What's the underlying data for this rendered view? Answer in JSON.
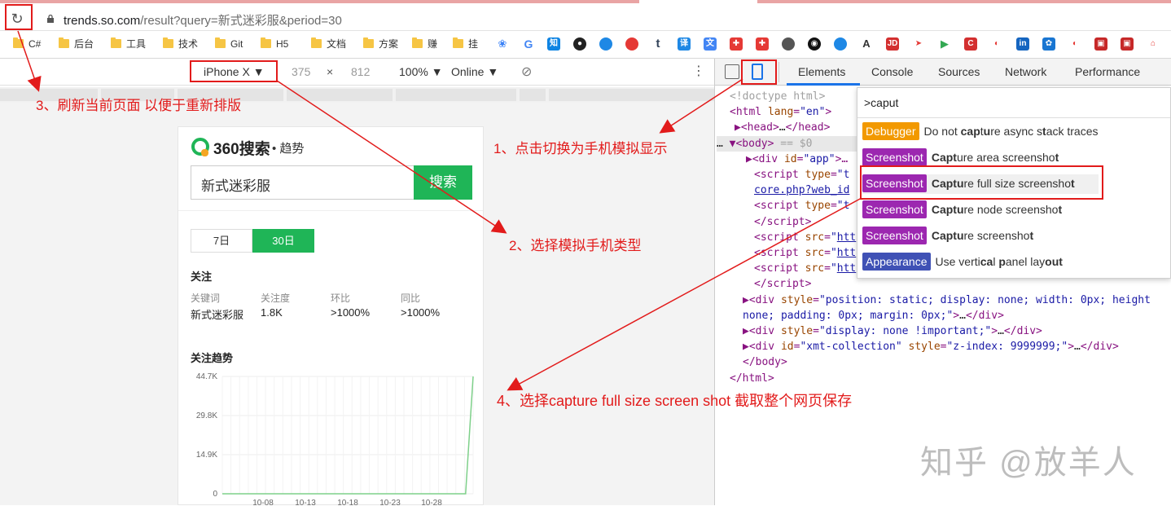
{
  "address_bar": {
    "host": "trends.so.com",
    "path": "/result?query=新式迷彩服&period=30"
  },
  "bookmarks": [
    {
      "type": "folder",
      "label": "C#"
    },
    {
      "type": "folder",
      "label": "后台"
    },
    {
      "type": "folder",
      "label": "工具"
    },
    {
      "type": "folder",
      "label": "技术"
    },
    {
      "type": "folder",
      "label": "Git"
    },
    {
      "type": "folder",
      "label": "H5"
    },
    {
      "type": "folder",
      "label": "文档"
    },
    {
      "type": "folder",
      "label": "方案"
    },
    {
      "type": "folder",
      "label": "赚"
    },
    {
      "type": "folder",
      "label": "挂"
    }
  ],
  "device_toolbar": {
    "device": "iPhone X",
    "width": "375",
    "times": "×",
    "height": "812",
    "zoom": "100%",
    "network": "Online"
  },
  "page": {
    "logo_text": "360搜索",
    "logo_suffix": "• 趋势",
    "search_value": "新式迷彩服",
    "search_button": "搜索",
    "period_tabs": [
      "7日",
      "30日"
    ],
    "section_follow": "关注",
    "stats_headers": [
      "关键词",
      "关注度",
      "环比",
      "同比"
    ],
    "stats_values": [
      "新式迷彩服",
      "1.8K",
      ">1000%",
      ">1000%"
    ],
    "section_trend": "关注趋势"
  },
  "chart_data": {
    "type": "line",
    "title": "关注趋势",
    "y_ticks": [
      "44.7K",
      "29.8K",
      "14.9K",
      "0"
    ],
    "x_ticks": [
      "10-08",
      "10-13",
      "10-18",
      "10-23",
      "10-28"
    ],
    "ylim": [
      0,
      44700
    ],
    "grid": true,
    "series": [
      {
        "color": "#7ed08a",
        "points": [
          [
            0,
            0
          ],
          [
            0.97,
            0
          ],
          [
            1.0,
            44700
          ]
        ]
      }
    ]
  },
  "devtools": {
    "tabs": [
      "Elements",
      "Console",
      "Sources",
      "Network",
      "Performance",
      "M"
    ],
    "dom_lines": [
      {
        "html": "<span class='cm'>&lt;!doctype html&gt;</span>"
      },
      {
        "html": "&lt;html <span class='at'>lang</span>=<span class='av'>\"en\"</span>&gt;"
      },
      {
        "html": "▶&lt;head&gt;<span class='tx'>…</span>&lt;/head&gt;"
      },
      {
        "html": "▼&lt;body&gt; <span class='cm'>== $0</span>"
      },
      {
        "html": "▶&lt;div <span class='at'>id</span>=<span class='av'>\"app\"</span>&gt;…"
      },
      {
        "html": "&lt;script <span class='at'>type</span>=<span class='av'>\"t</span>"
      },
      {
        "html": "<span class='lk'>core.php?web_id</span>"
      },
      {
        "html": "&lt;script <span class='at'>type</span>=<span class='av'>\"t</span>"
      },
      {
        "html": "&lt;/script&gt;"
      },
      {
        "html": "&lt;script <span class='at'>src</span>=<span class='av'>\"<span class='lk'>htt</span></span>"
      },
      {
        "html": "&lt;script <span class='at'>src</span>=<span class='av'>\"<span class='lk'>htt</span></span>"
      },
      {
        "html": "&lt;script <span class='at'>src</span>=<span class='av'>\"<span class='lk'>htt</span></span>"
      },
      {
        "html": "&lt;/script&gt;"
      },
      {
        "html": "▶&lt;div <span class='at'>style</span>=<span class='av'>\"position: static; display: none; width: 0px; height</span>"
      },
      {
        "html": "<span class='av'>none; padding: 0px; margin: 0px;\"</span>&gt;<span class='tx'>…</span>&lt;/div&gt;"
      },
      {
        "html": "▶&lt;div <span class='at'>style</span>=<span class='av'>\"display: none !important;\"</span>&gt;<span class='tx'>…</span>&lt;/div&gt;"
      },
      {
        "html": "▶&lt;div <span class='at'>id</span>=<span class='av'>\"xmt-collection\"</span> <span class='at'>style</span>=<span class='av'>\"z-index: 9999999;\"</span>&gt;<span class='tx'>…</span>&lt;/div&gt;"
      },
      {
        "html": "&lt;/body&gt;"
      },
      {
        "html": "&lt;/html&gt;"
      }
    ],
    "command_query": ">caput",
    "commands": [
      {
        "badge": "Debugger",
        "color": "#f29900",
        "text_html": "Do not <b>cap</b>t<b>u</b>re async s<b>t</b>ack traces"
      },
      {
        "badge": "Screenshot",
        "color": "#9c27b0",
        "text_html": "<b>Capt</b>ure area screensho<b>t</b>"
      },
      {
        "badge": "Screenshot",
        "color": "#9c27b0",
        "text_html": "<b>Captu</b>re full size screensho<b>t</b>"
      },
      {
        "badge": "Screenshot",
        "color": "#9c27b0",
        "text_html": "<b>Captu</b>re node screensho<b>t</b>"
      },
      {
        "badge": "Screenshot",
        "color": "#9c27b0",
        "text_html": "<b>Captu</b>re screensho<b>t</b>"
      },
      {
        "badge": "Appearance",
        "color": "#3f51b5",
        "text_html": "Use verti<b>ca</b>l <b>p</b>anel lay<b>out</b>"
      }
    ]
  },
  "annotations": {
    "step3": "3、刷新当前页面 以便于重新排版",
    "step1": "1、点击切换为手机模拟显示",
    "step2": "2、选择模拟手机类型",
    "step4": "4、选择capture full size screen shot 截取整个网页保存"
  },
  "watermark": "知乎 @放羊人",
  "colors": {
    "annotation": "#e21b1b",
    "brand_green": "#1fb557"
  }
}
